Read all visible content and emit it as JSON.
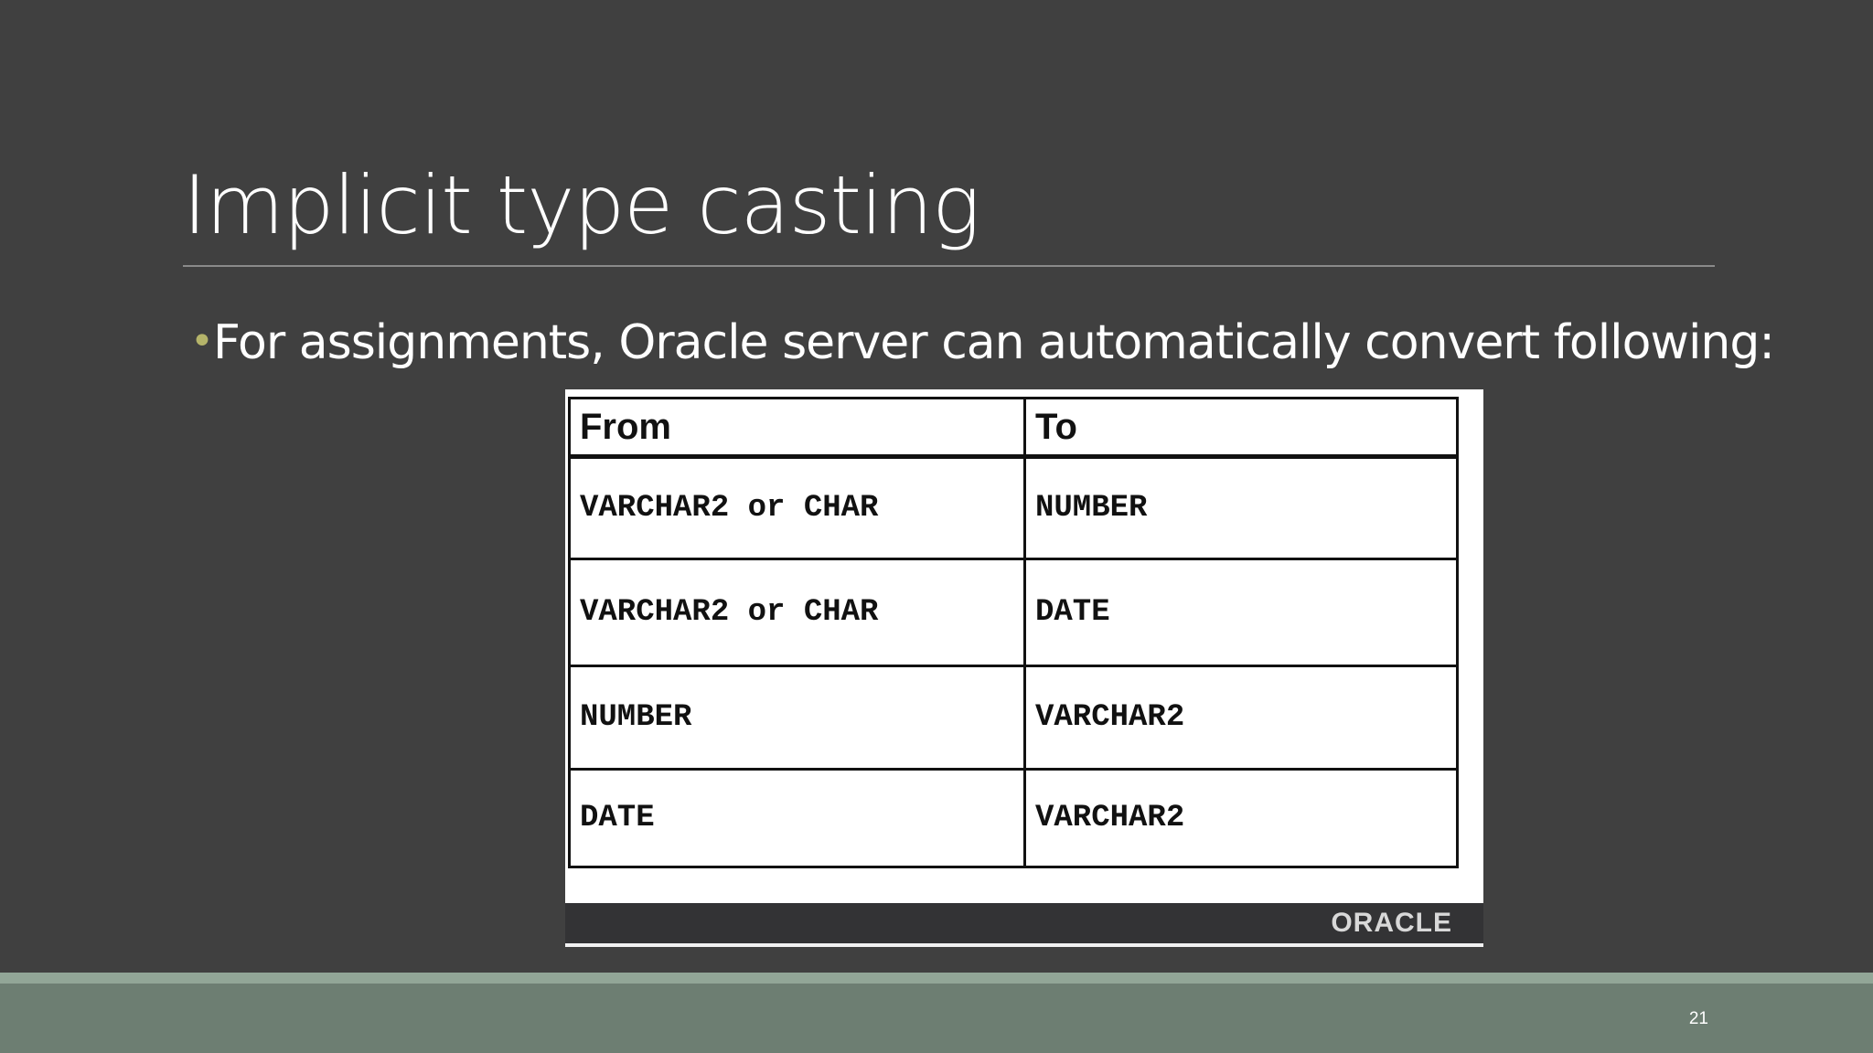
{
  "slide": {
    "title": "Implicit type casting",
    "bullet_symbol": "•",
    "bullet_text": "For assignments, Oracle server can automatically convert following:",
    "page_number": "21"
  },
  "table": {
    "headers": [
      "From",
      "To"
    ],
    "rows": [
      [
        "VARCHAR2 or CHAR",
        "NUMBER"
      ],
      [
        "VARCHAR2 or CHAR",
        "DATE"
      ],
      [
        "NUMBER",
        "VARCHAR2"
      ],
      [
        "DATE",
        "VARCHAR2"
      ]
    ],
    "logo_text": "ORACLE"
  },
  "colors": {
    "background": "#404040",
    "title_text": "#ffffff",
    "bullet_accent": "#b5b46a",
    "footer": "#6d7e72",
    "footer_stripe": "#92a697"
  }
}
